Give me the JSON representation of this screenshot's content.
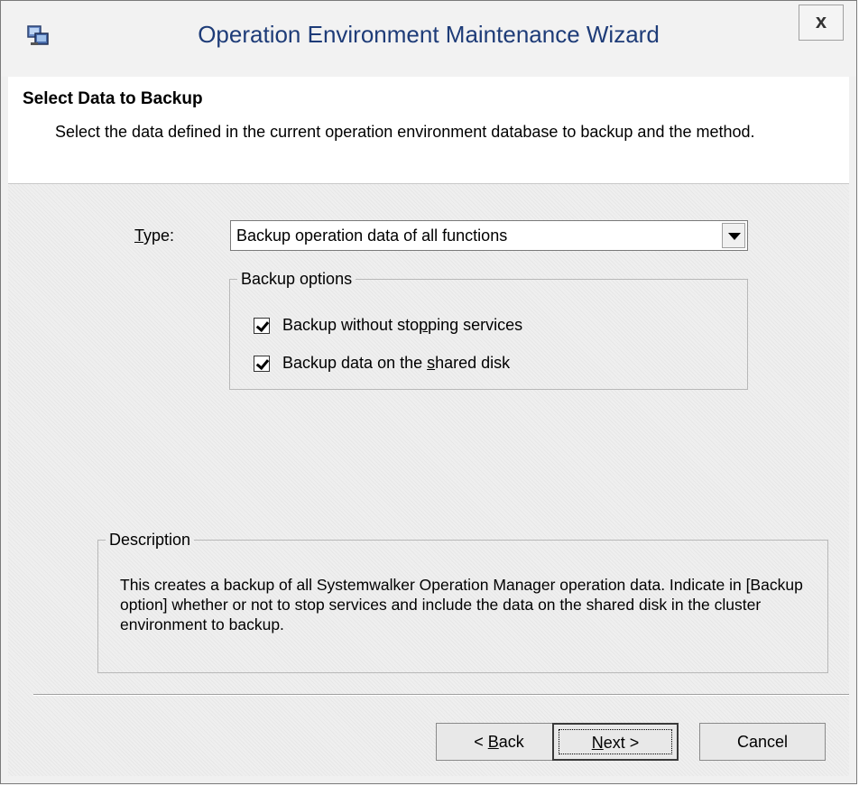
{
  "window": {
    "title": "Operation Environment Maintenance Wizard",
    "close_label": "x"
  },
  "header": {
    "title": "Select Data to Backup",
    "description": "Select the data defined in the current operation environment database to backup and the method."
  },
  "type": {
    "label_accel": "T",
    "label_rest": "ype:",
    "selected": "Backup operation data of all functions"
  },
  "backup_options": {
    "legend": "Backup options",
    "options": [
      {
        "label_pre": "Backup without sto",
        "accel": "p",
        "label_post": "ping services",
        "checked": true
      },
      {
        "label_pre": "Backup data on the ",
        "accel": "s",
        "label_post": "hared disk",
        "checked": true
      }
    ]
  },
  "description": {
    "legend": "Description",
    "text": "This creates a backup of all Systemwalker Operation Manager operation data. Indicate in [Backup option] whether or not to stop services and include the data on the shared disk in the cluster environment to backup."
  },
  "buttons": {
    "back_pre": "< ",
    "back_accel": "B",
    "back_post": "ack",
    "next_accel": "N",
    "next_post": "ext >",
    "cancel": "Cancel"
  }
}
